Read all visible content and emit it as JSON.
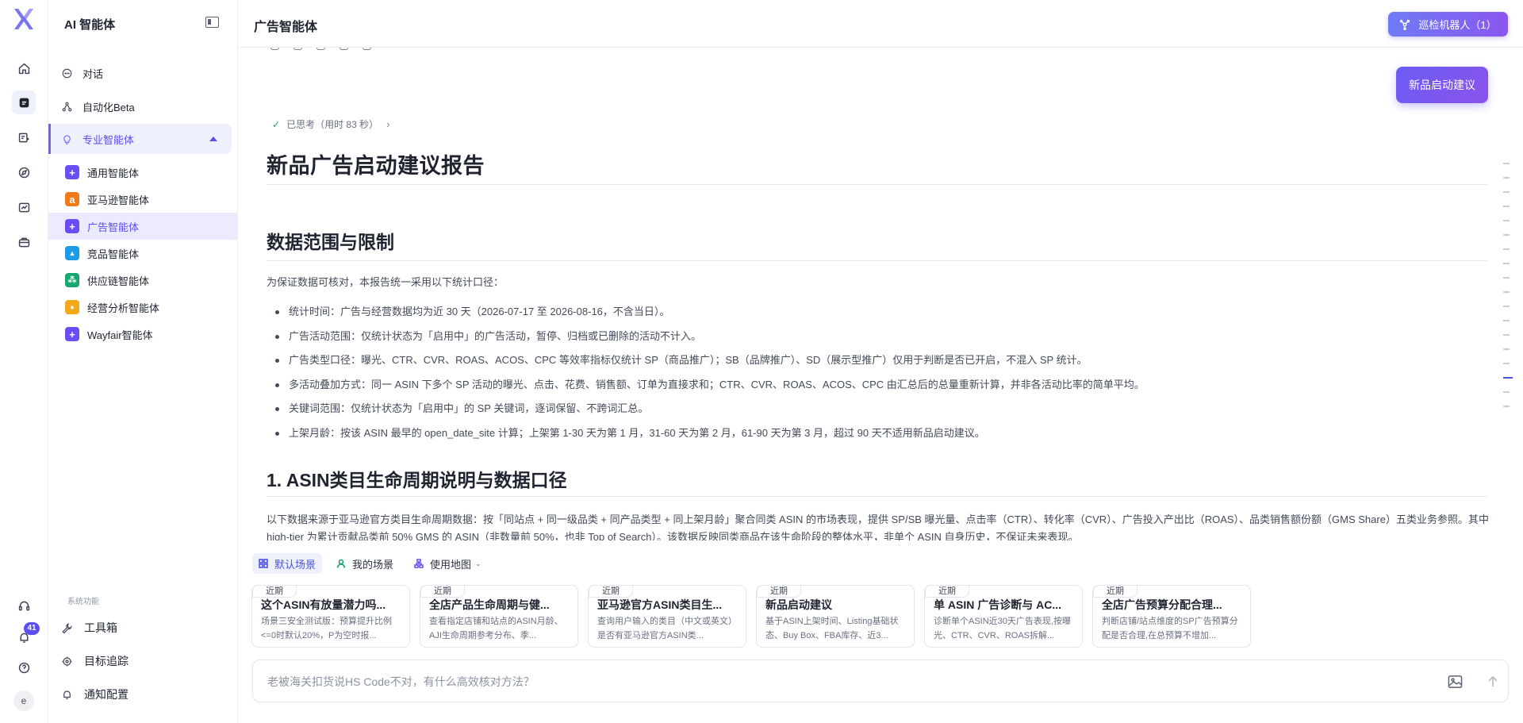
{
  "sidebar": {
    "title": "AI 智能体",
    "nav": [
      {
        "label": "对话",
        "icon": "chat-icon"
      },
      {
        "label": "自动化Beta",
        "icon": "workflow-icon"
      },
      {
        "label": "专业智能体",
        "icon": "bulb-icon"
      }
    ],
    "agents": [
      {
        "label": "通用智能体",
        "icon": "plus-square-icon",
        "color": "#6a4df5",
        "glyph": "+"
      },
      {
        "label": "亚马逊智能体",
        "icon": "amazon-icon",
        "color": "#f07a1a",
        "glyph": "a"
      },
      {
        "label": "广告智能体",
        "icon": "plus-square-icon",
        "color": "#6a4df5",
        "glyph": "+"
      },
      {
        "label": "竞品智能体",
        "icon": "rocket-icon",
        "color": "#1c9be6",
        "glyph": "▲"
      },
      {
        "label": "供应链智能体",
        "icon": "network-icon",
        "color": "#16a66e",
        "glyph": "⁂"
      },
      {
        "label": "经营分析智能体",
        "icon": "lightbulb-icon",
        "color": "#f4a81c",
        "glyph": "●"
      },
      {
        "label": "Wayfair智能体",
        "icon": "plus-square-icon",
        "color": "#6a4df5",
        "glyph": "+"
      }
    ],
    "system_label": "系统功能",
    "system": [
      {
        "label": "工具箱"
      },
      {
        "label": "目标追踪"
      },
      {
        "label": "通知配置"
      }
    ],
    "notification_count": "41",
    "avatar_initial": "e"
  },
  "header": {
    "title": "广告智能体",
    "patrol_button": "巡检机器人（1）"
  },
  "report": {
    "launch_button": "新品启动建议",
    "thought": "已思考（用时 83 秒）",
    "title": "新品广告启动建议报告",
    "section1_title": "数据范围与限制",
    "section1_intro": "为保证数据可核对，本报告统一采用以下统计口径：",
    "bullets": [
      "统计时间：广告与经营数据均为近 30 天（2026-07-17 至 2026-08-16，不含当日）。",
      "广告活动范围：仅统计状态为「启用中」的广告活动，暂停、归档或已删除的活动不计入。",
      "广告类型口径：曝光、CTR、CVR、ROAS、ACOS、CPC 等效率指标仅统计 SP（商品推广）；SB（品牌推广）、SD（展示型推广）仅用于判断是否已开启，不混入 SP 统计。",
      "多活动叠加方式：同一 ASIN 下多个 SP 活动的曝光、点击、花费、销售额、订单为直接求和；CTR、CVR、ROAS、ACOS、CPC 由汇总后的总量重新计算，并非各活动比率的简单平均。",
      "关键词范围：仅统计状态为「启用中」的 SP 关键词，逐词保留、不跨词汇总。",
      "上架月龄：按该 ASIN 最早的 open_date_site 计算；上架第 1-30 天为第 1 月，31-60 天为第 2 月，61-90 天为第 3 月，超过 90 天不适用新品启动建议。"
    ],
    "section2_title": "1. ASIN类目生命周期说明与数据口径",
    "section2_para": "以下数据来源于亚马逊官方类目生命周期数据：按「同站点 + 同一级品类 + 同产品类型 + 同上架月龄」聚合同类 ASIN 的市场表现，提供 SP/SB 曝光量、点击率（CTR）、转化率（CVR）、广告投入产出比（ROAS）、品类销售额份额（GMS Share）五类业务参照。其中 high-tier 为累计贡献品类前 50% GMS 的 ASIN（非数量前 50%，也非 Top of Search）。该数据反映同类商品在该生命阶段的整体水平，非单个 ASIN 自身历史，不保证未来表现。"
  },
  "scenes": {
    "tabs": [
      {
        "label": "默认场景"
      },
      {
        "label": "我的场景"
      },
      {
        "label": "使用地图"
      }
    ],
    "cards": [
      {
        "tag": "近期",
        "title": "这个ASIN有放量潜力吗...",
        "desc": "场景三安全测试版：预算提升比例<=0时默认20%，P为空时报..."
      },
      {
        "tag": "近期",
        "title": "全店产品生命周期与健...",
        "desc": "查看指定店铺和站点的ASIN月龄、AJI生命周期参考分布、季..."
      },
      {
        "tag": "近期",
        "title": "亚马逊官方ASIN类目生...",
        "desc": "查询用户输入的类目（中文或英文）是否有亚马逊官方ASIN类..."
      },
      {
        "tag": "近期",
        "title": "新品启动建议",
        "desc": "基于ASIN上架时间、Listing基础状态、Buy Box、FBA库存、近3..."
      },
      {
        "tag": "近期",
        "title": "单 ASIN 广告诊断与 AC...",
        "desc": "诊断单个ASIN近30天广告表现,按曝光、CTR、CVR、ROAS拆解..."
      },
      {
        "tag": "近期",
        "title": "全店广告预算分配合理...",
        "desc": "判断店铺/站点维度的SP广告预算分配是否合理,在总预算不增加..."
      }
    ]
  },
  "composer": {
    "placeholder": "老被海关扣货说HS Code不对，有什么高效核对方法？"
  },
  "colors": {
    "accent": "#5b4ef0",
    "accent_light": "#eef0fb"
  }
}
